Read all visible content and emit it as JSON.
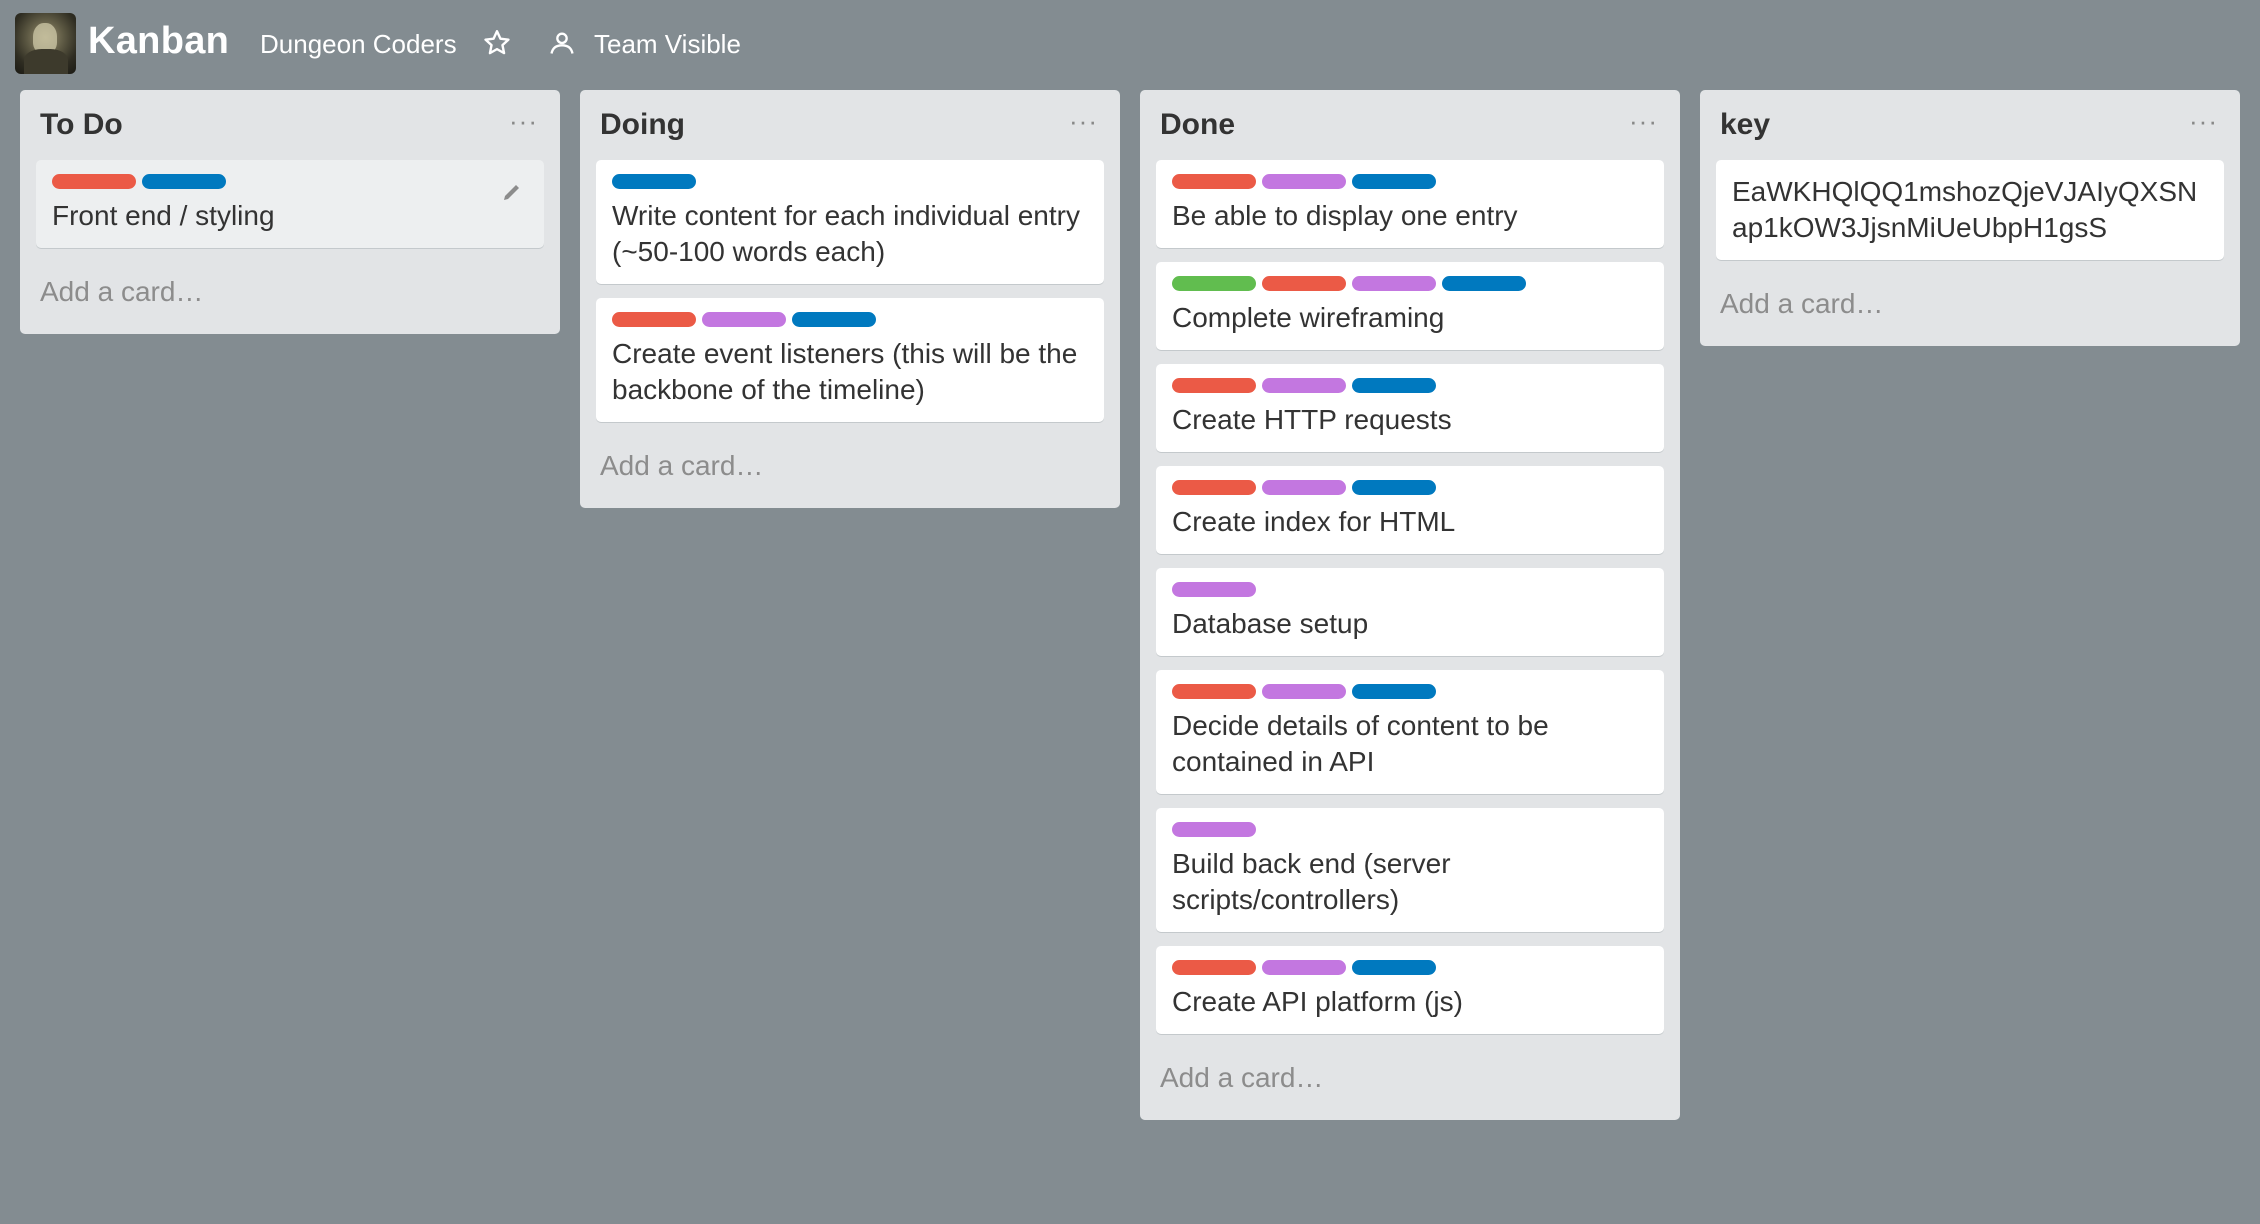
{
  "header": {
    "board_title": "Kanban",
    "team_name": "Dungeon Coders",
    "visibility": "Team Visible"
  },
  "label_colors": {
    "red": "#eb5a46",
    "purple": "#c377e0",
    "blue": "#0079bf",
    "green": "#61bd4f"
  },
  "lists": [
    {
      "title": "To Do",
      "menu": "···",
      "add_card": "Add a card…",
      "cards": [
        {
          "title": "Front end / styling",
          "labels": [
            "red",
            "blue"
          ]
        }
      ]
    },
    {
      "title": "Doing",
      "menu": "···",
      "add_card": "Add a card…",
      "cards": [
        {
          "title": "Write content for each individual entry (~50-100 words each)",
          "labels": [
            "blue"
          ]
        },
        {
          "title": "Create event listeners (this will be the backbone of the timeline)",
          "labels": [
            "red",
            "purple",
            "blue"
          ]
        }
      ]
    },
    {
      "title": "Done",
      "menu": "···",
      "add_card": "Add a card…",
      "cards": [
        {
          "title": "Be able to display one entry",
          "labels": [
            "red",
            "purple",
            "blue"
          ]
        },
        {
          "title": "Complete wireframing",
          "labels": [
            "green",
            "red",
            "purple",
            "blue"
          ]
        },
        {
          "title": "Create HTTP requests",
          "labels": [
            "red",
            "purple",
            "blue"
          ]
        },
        {
          "title": "Create index for HTML",
          "labels": [
            "red",
            "purple",
            "blue"
          ]
        },
        {
          "title": "Database setup",
          "labels": [
            "purple"
          ]
        },
        {
          "title": "Decide details of content to be contained in API",
          "labels": [
            "red",
            "purple",
            "blue"
          ]
        },
        {
          "title": "Build back end (server scripts/controllers)",
          "labels": [
            "purple"
          ]
        },
        {
          "title": "Create API platform (js)",
          "labels": [
            "red",
            "purple",
            "blue"
          ]
        }
      ]
    },
    {
      "title": "key",
      "menu": "···",
      "add_card": "Add a card…",
      "cards": [
        {
          "title": "EaWKHQlQQ1mshozQjeVJAIyQXSNap1kOW3JjsnMiUeUbpH1gsS",
          "labels": []
        }
      ]
    }
  ]
}
